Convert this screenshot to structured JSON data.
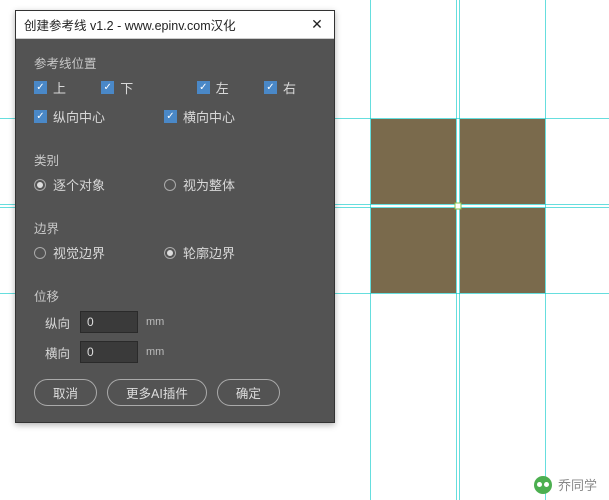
{
  "dialog": {
    "title": "创建参考线 v1.2 - www.epinv.com汉化",
    "sections": {
      "position": {
        "label": "参考线位置",
        "items": {
          "top": {
            "label": "上",
            "checked": true
          },
          "bottom": {
            "label": "下",
            "checked": true
          },
          "left": {
            "label": "左",
            "checked": true
          },
          "right": {
            "label": "右",
            "checked": true
          },
          "vcenter": {
            "label": "纵向中心",
            "checked": true
          },
          "hcenter": {
            "label": "横向中心",
            "checked": true
          }
        }
      },
      "category": {
        "label": "类别",
        "each": {
          "label": "逐个对象",
          "selected": true
        },
        "whole": {
          "label": "视为整体",
          "selected": false
        }
      },
      "bound": {
        "label": "边界",
        "visual": {
          "label": "视觉边界",
          "selected": false
        },
        "outline": {
          "label": "轮廓边界",
          "selected": true
        }
      },
      "offset": {
        "label": "位移",
        "v": {
          "label": "纵向",
          "value": "0",
          "unit": "mm"
        },
        "h": {
          "label": "横向",
          "value": "0",
          "unit": "mm"
        }
      }
    },
    "buttons": {
      "cancel": "取消",
      "more": "更多AI插件",
      "ok": "确定"
    }
  },
  "watermark": {
    "label": "乔同学"
  }
}
